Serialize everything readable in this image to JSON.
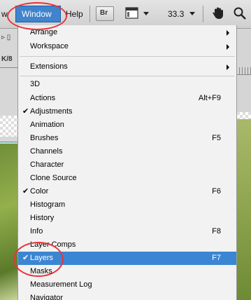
{
  "menubar": {
    "prev_item": "w",
    "window": "Window",
    "help": "Help",
    "br_label": "Br",
    "zoom": "33.3"
  },
  "background": {
    "left_label": "K/8"
  },
  "menu": {
    "items": [
      {
        "label": "Arrange",
        "shortcut": "",
        "checked": false,
        "submenu": true
      },
      {
        "label": "Workspace",
        "shortcut": "",
        "checked": false,
        "submenu": true
      },
      {
        "label": "Extensions",
        "shortcut": "",
        "checked": false,
        "submenu": true
      },
      {
        "label": "3D",
        "shortcut": "",
        "checked": false,
        "submenu": false
      },
      {
        "label": "Actions",
        "shortcut": "Alt+F9",
        "checked": false,
        "submenu": false
      },
      {
        "label": "Adjustments",
        "shortcut": "",
        "checked": true,
        "submenu": false
      },
      {
        "label": "Animation",
        "shortcut": "",
        "checked": false,
        "submenu": false
      },
      {
        "label": "Brushes",
        "shortcut": "F5",
        "checked": false,
        "submenu": false
      },
      {
        "label": "Channels",
        "shortcut": "",
        "checked": false,
        "submenu": false
      },
      {
        "label": "Character",
        "shortcut": "",
        "checked": false,
        "submenu": false
      },
      {
        "label": "Clone Source",
        "shortcut": "",
        "checked": false,
        "submenu": false
      },
      {
        "label": "Color",
        "shortcut": "F6",
        "checked": true,
        "submenu": false
      },
      {
        "label": "Histogram",
        "shortcut": "",
        "checked": false,
        "submenu": false
      },
      {
        "label": "History",
        "shortcut": "",
        "checked": false,
        "submenu": false
      },
      {
        "label": "Info",
        "shortcut": "F8",
        "checked": false,
        "submenu": false
      },
      {
        "label": "Layer Comps",
        "shortcut": "",
        "checked": false,
        "submenu": false
      },
      {
        "label": "Layers",
        "shortcut": "F7",
        "checked": true,
        "submenu": false,
        "highlighted": true
      },
      {
        "label": "Masks",
        "shortcut": "",
        "checked": false,
        "submenu": false
      },
      {
        "label": "Measurement Log",
        "shortcut": "",
        "checked": false,
        "submenu": false
      },
      {
        "label": "Navigator",
        "shortcut": "",
        "checked": false,
        "submenu": false
      }
    ],
    "check_glyph": "✔"
  },
  "colors": {
    "highlight": "#3b86d2",
    "annotation": "#e8343a"
  },
  "icons": [
    "hand-icon",
    "zoom-icon",
    "screen-mode-icon",
    "bridge-icon"
  ]
}
